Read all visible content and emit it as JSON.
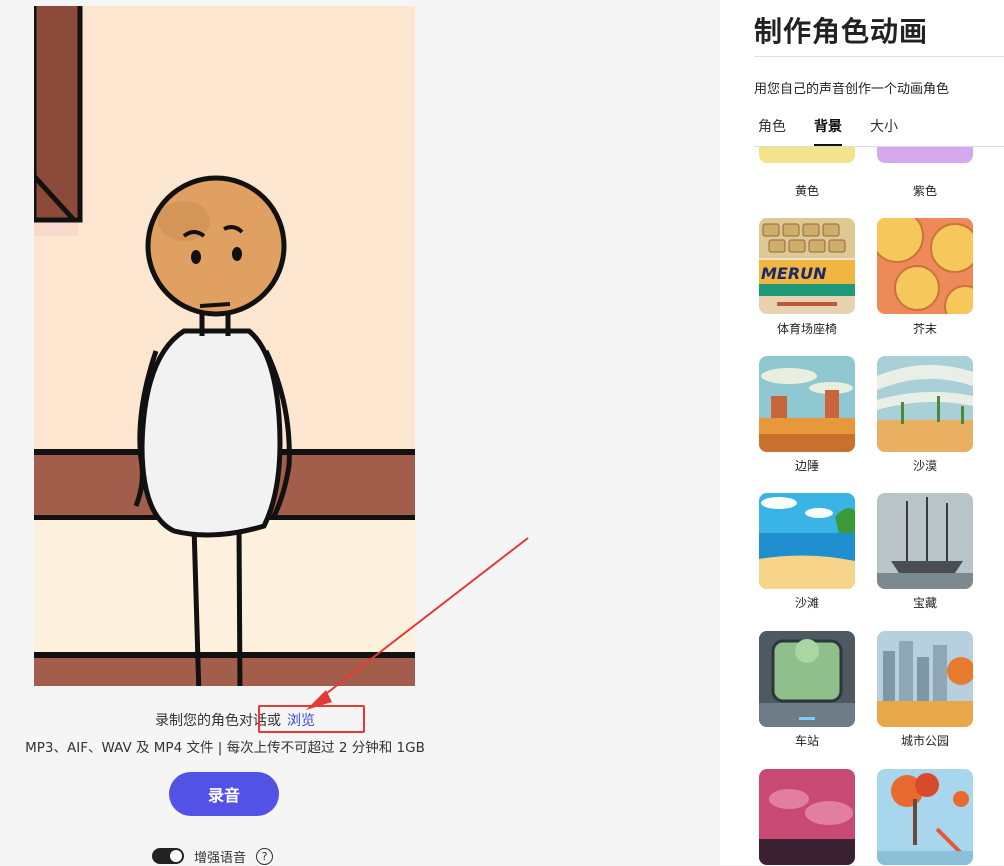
{
  "left": {
    "caption_text": "录制您的角色对话或",
    "browse_link": "浏览",
    "formats_text": "MP3、AIF、WAV 及 MP4 文件 | 每次上传不可超过 2 分钟和 1GB",
    "record_button": "录音",
    "enhance_label": "增强语音",
    "help_glyph": "?"
  },
  "panel": {
    "title": "制作角色动画",
    "description": "用您自己的声音创作一个动画角色",
    "tabs": [
      {
        "label": "角色",
        "active": false
      },
      {
        "label": "背景",
        "active": true
      },
      {
        "label": "大小",
        "active": false
      }
    ],
    "backgrounds": [
      {
        "label": "黄色",
        "icon": "yellow-swatch"
      },
      {
        "label": "紫色",
        "icon": "purple-swatch"
      },
      {
        "label": "体育场座椅",
        "icon": "stadium-seats-thumbnail"
      },
      {
        "label": "芥末",
        "icon": "mustard-thumbnail"
      },
      {
        "label": "边陲",
        "icon": "frontier-thumbnail"
      },
      {
        "label": "沙漠",
        "icon": "desert-thumbnail"
      },
      {
        "label": "沙滩",
        "icon": "beach-thumbnail"
      },
      {
        "label": "宝藏",
        "icon": "treasure-ship-thumbnail"
      },
      {
        "label": "车站",
        "icon": "station-thumbnail"
      },
      {
        "label": "城市公园",
        "icon": "city-park-thumbnail"
      },
      {
        "label": "",
        "icon": "pink-landscape-thumbnail"
      },
      {
        "label": "",
        "icon": "playground-thumbnail"
      }
    ],
    "stadium_sign_text": "MERUN"
  },
  "colors": {
    "accent": "#5252e6",
    "link": "#3a49e0",
    "annotation_red": "#e53935",
    "stage_bg": "#fde6d0"
  }
}
